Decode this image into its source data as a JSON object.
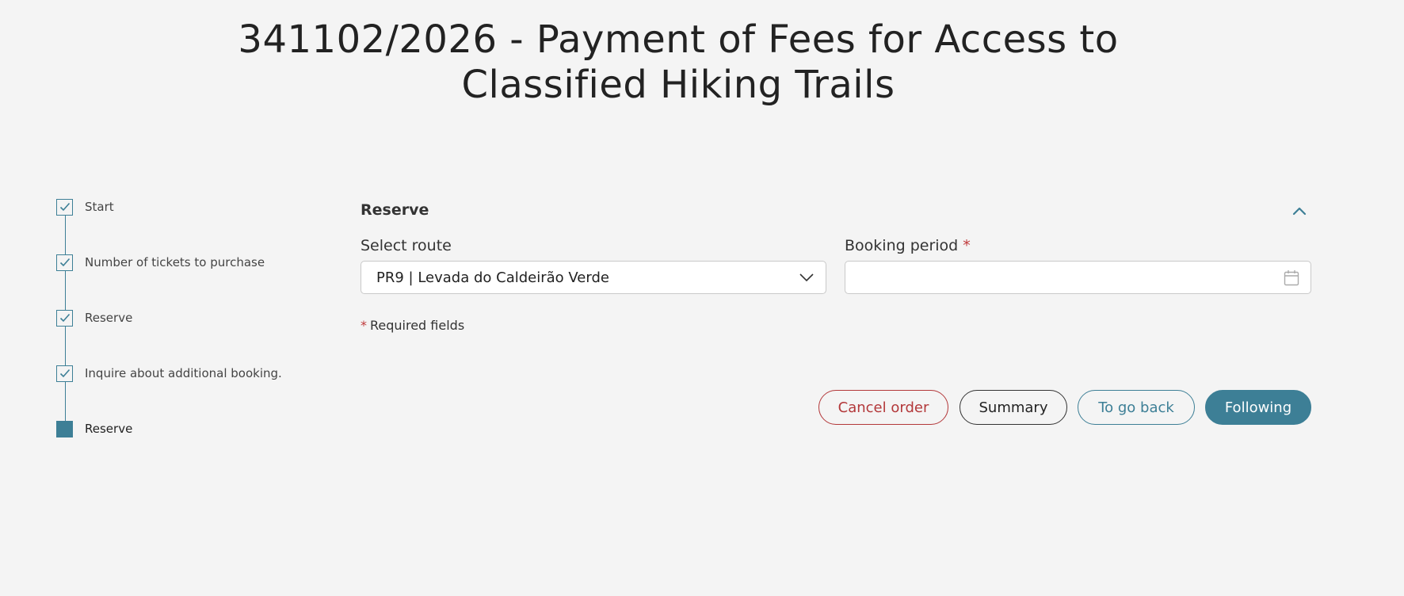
{
  "header": {
    "title_line1": "341102/2026 - Payment of Fees for Access to",
    "title_line2": "Classified Hiking Trails"
  },
  "stepper": {
    "steps": [
      {
        "label": "Start",
        "state": "completed"
      },
      {
        "label": "Number of tickets to purchase",
        "state": "completed"
      },
      {
        "label": "Reserve",
        "state": "completed"
      },
      {
        "label": "Inquire about additional booking.",
        "state": "completed"
      },
      {
        "label": "Reserve",
        "state": "current"
      }
    ]
  },
  "section": {
    "title": "Reserve",
    "collapse_icon": "chevron-up-icon"
  },
  "form": {
    "route_label": "Select route",
    "route_value": "PR9 | Levada do Caldeirão Verde",
    "period_label": "Booking period",
    "period_required": "*",
    "period_value": "",
    "required_star": "*",
    "required_note": "Required fields"
  },
  "actions": {
    "cancel": "Cancel order",
    "summary": "Summary",
    "back": "To go back",
    "next": "Following"
  },
  "colors": {
    "accent": "#3d7f96",
    "danger": "#b3383a",
    "background": "#f4f4f4"
  }
}
